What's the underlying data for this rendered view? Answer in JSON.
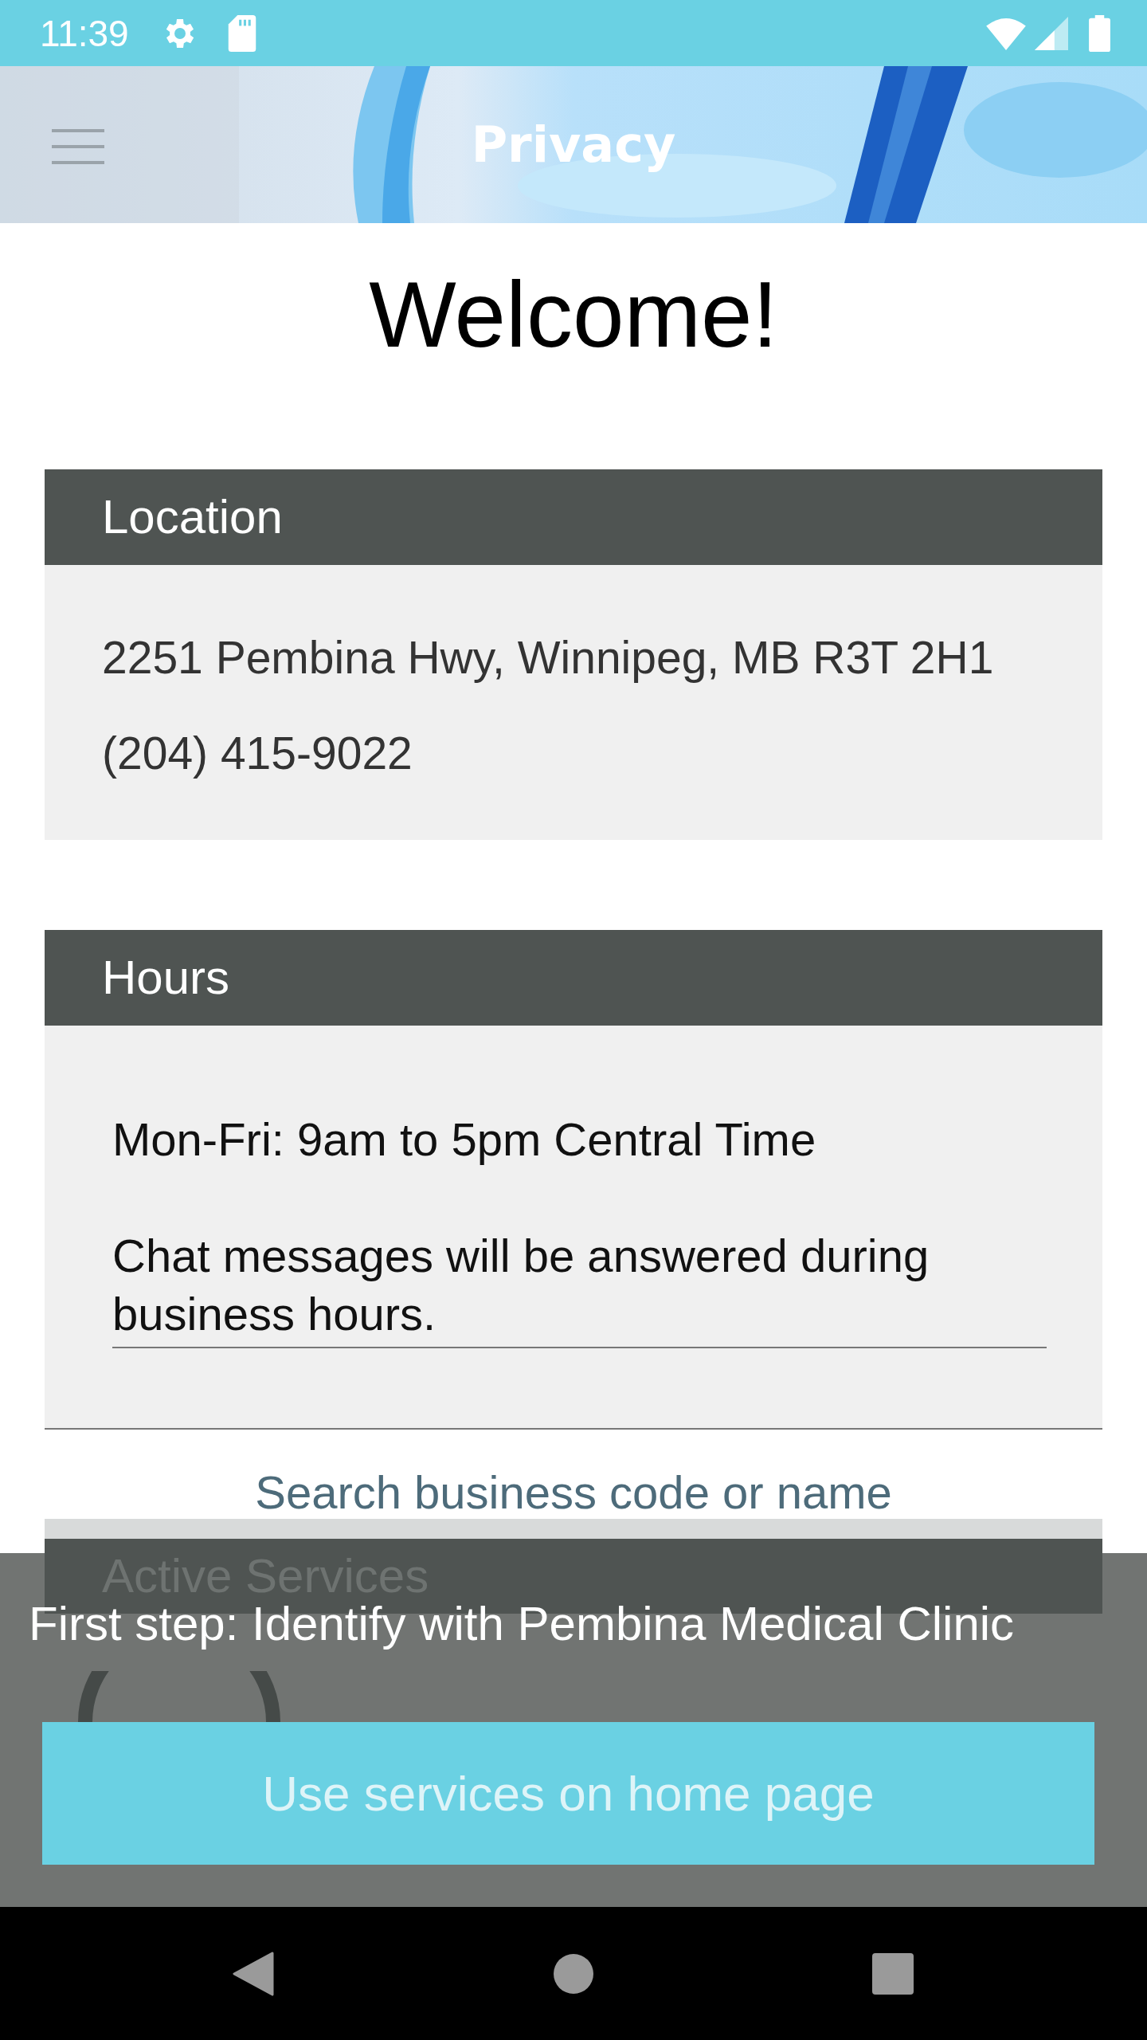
{
  "status_bar": {
    "time": "11:39"
  },
  "header": {
    "title": "Privacy"
  },
  "welcome": "Welcome!",
  "cards": [
    {
      "kind": "lines",
      "title": "Location",
      "lines": [
        "2251 Pembina Hwy, Winnipeg, MB R3T 2H1",
        "(204) 415-9022"
      ]
    },
    {
      "kind": "field",
      "title": "Hours",
      "value": "Mon-Fri: 9am to 5pm Central Time\n\nChat messages will be answered during business hours."
    }
  ],
  "search_link": "Search business code or name",
  "services": {
    "title": "Active Services"
  },
  "prompt": {
    "message": "First step: Identify with Pembina Medical Clinic",
    "button": "Use services on home page"
  }
}
